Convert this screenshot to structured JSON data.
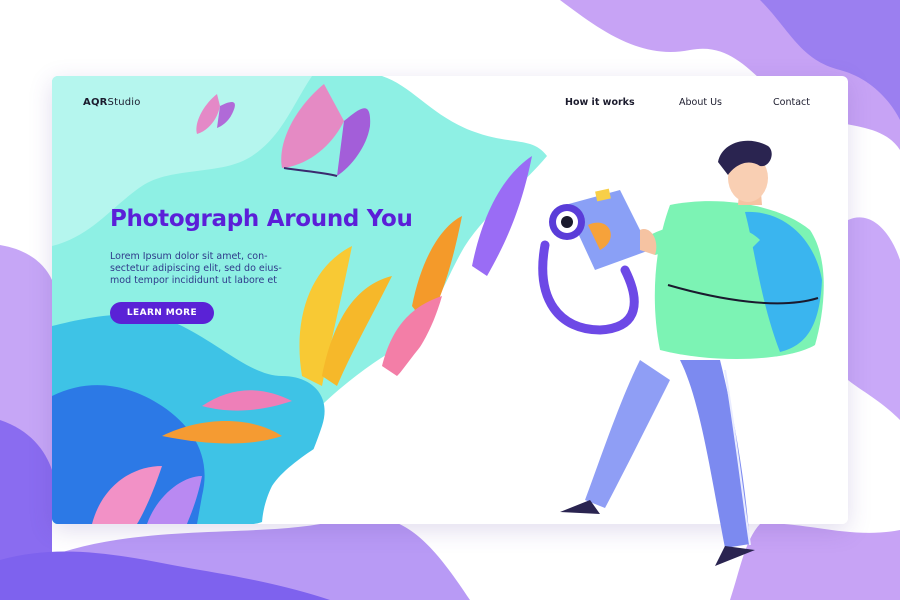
{
  "brand": {
    "prefix": "AQR",
    "suffix": "Studio"
  },
  "nav": [
    {
      "label": "How it works",
      "active": true
    },
    {
      "label": "About Us",
      "active": false
    },
    {
      "label": "Contact",
      "active": false
    }
  ],
  "hero": {
    "title": "Photograph Around You",
    "text_line1": "Lorem Ipsum dolor sit amet, con-",
    "text_line2": "sectetur adipiscing elit, sed do eius-",
    "text_line3": "mod tempor incididunt ut labore et",
    "cta_label": "LEARN MORE"
  },
  "colors": {
    "accent": "#5a22d6",
    "title": "#5b1fd8",
    "teal": "#8ef0e4",
    "lavender": "#c7a3f5",
    "violet": "#7a5cf0"
  },
  "icons": [
    "camera-icon",
    "butterfly-icon"
  ]
}
